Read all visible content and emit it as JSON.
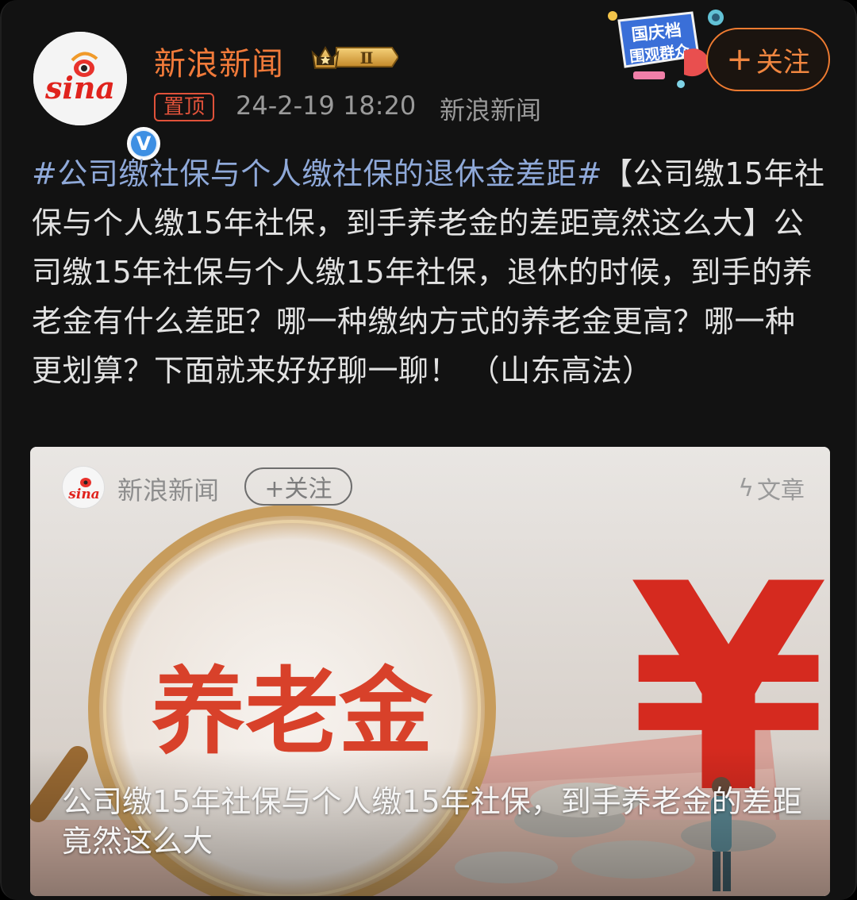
{
  "author": {
    "name": "新浪新闻",
    "avatar_logo": "sina",
    "verified": "V",
    "level_badge": "Ⅱ",
    "pin_label": "置顶",
    "timestamp": "24-2-19 18:20",
    "source": "新浪新闻"
  },
  "promo": {
    "line1": "国庆档",
    "line2": "围观群众"
  },
  "follow_button": {
    "icon": "plus-icon",
    "label": "关注"
  },
  "post": {
    "topic": "#公司缴社保与个人缴社保的退休金差距#",
    "body": "【公司缴15年社保与个人缴15年社保，到手养老金的差距竟然这么大】公司缴15年社保与个人缴15年社保，退休的时候，到手的养老金有什么差距？哪一种缴纳方式的养老金更高？哪一种更划算？下面就来好好聊一聊！ （山东高法）"
  },
  "article_card": {
    "author_name": "新浪新闻",
    "follow_label": "+关注",
    "type_icon": "lightning-icon",
    "type_label": "文章",
    "image_caption": "养老金",
    "yen_symbol": "¥",
    "title": "公司缴15年社保与个人缴15年社保，到手养老金的差距竟然这么大"
  },
  "colors": {
    "background": "#121212",
    "accent_orange": "#f07a3a",
    "topic_blue": "#8fa9d9",
    "pin_red": "#e0523a",
    "meta_gray": "#9a9a9a"
  }
}
